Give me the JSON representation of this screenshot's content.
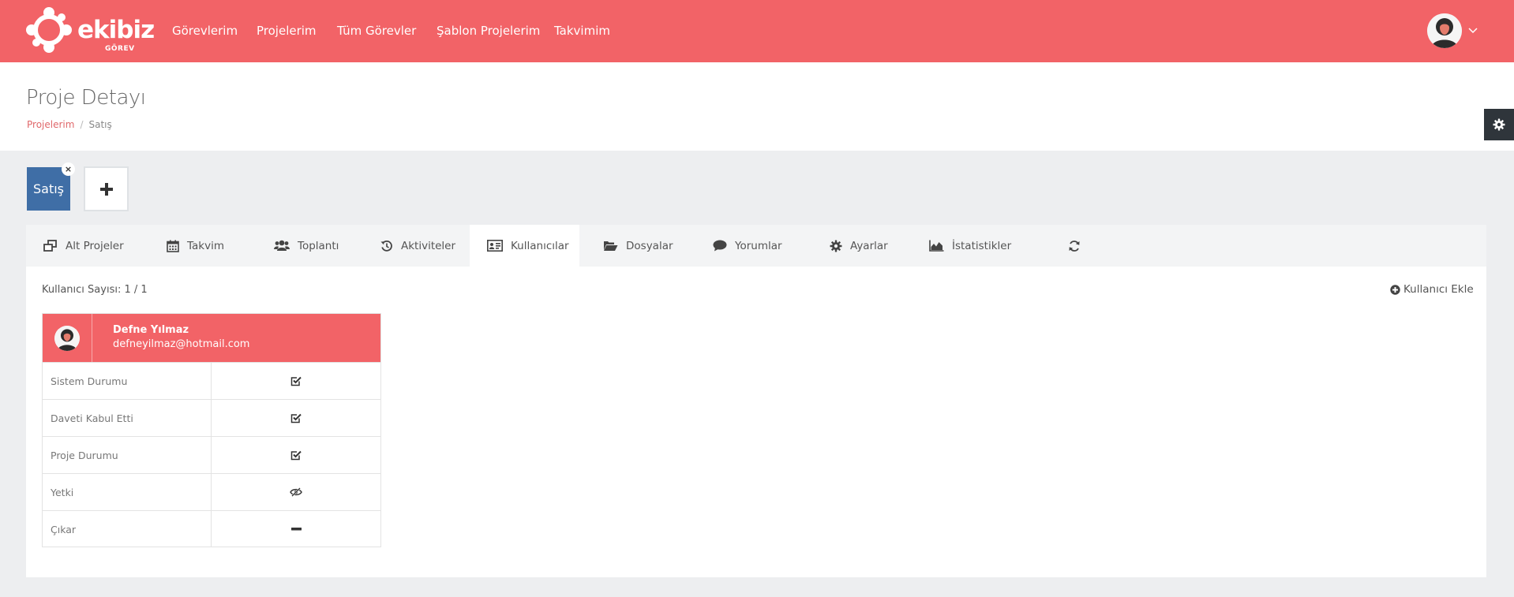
{
  "brand": {
    "name": "ekibiz",
    "sub": "GÖREV",
    "nav_color": "#f26367"
  },
  "nav": {
    "items": [
      {
        "label": "Görevlerim"
      },
      {
        "label": "Projelerim"
      },
      {
        "label": "Tüm Görevler"
      },
      {
        "label": "Şablon Projelerim"
      },
      {
        "label": "Takvimim"
      }
    ]
  },
  "header": {
    "title": "Proje Detayı",
    "breadcrumb": {
      "root": "Projelerim",
      "sep": "/",
      "current": "Satış"
    }
  },
  "project_tabs": {
    "active_label": "Satış",
    "close": "×",
    "active_color": "#3f6ea6"
  },
  "tabs": [
    {
      "label": "Alt Projeler",
      "icon": "clone-icon"
    },
    {
      "label": "Takvim",
      "icon": "calendar-icon"
    },
    {
      "label": "Toplantı",
      "icon": "users-icon"
    },
    {
      "label": "Aktiviteler",
      "icon": "history-icon"
    },
    {
      "label": "Kullanıcılar",
      "icon": "id-card-icon",
      "active": true
    },
    {
      "label": "Dosyalar",
      "icon": "folder-open-icon"
    },
    {
      "label": "Yorumlar",
      "icon": "comment-icon"
    },
    {
      "label": "Ayarlar",
      "icon": "gear-icon"
    },
    {
      "label": "İstatistikler",
      "icon": "area-chart-icon"
    },
    {
      "label": "",
      "icon": "refresh-icon"
    }
  ],
  "users": {
    "count_text": "Kullanıcı Sayısı: 1 / 1",
    "add_label": "Kullanıcı Ekle",
    "card": {
      "name": "Defne Yılmaz",
      "email": "defneyilmaz@hotmail.com",
      "rows": [
        {
          "label": "Sistem Durumu",
          "icon": "check-square-icon"
        },
        {
          "label": "Daveti Kabul Etti",
          "icon": "check-square-icon"
        },
        {
          "label": "Proje Durumu",
          "icon": "check-square-icon"
        },
        {
          "label": "Yetki",
          "icon": "eye-slash-icon"
        },
        {
          "label": "Çıkar",
          "icon": "minus-icon"
        }
      ]
    }
  }
}
